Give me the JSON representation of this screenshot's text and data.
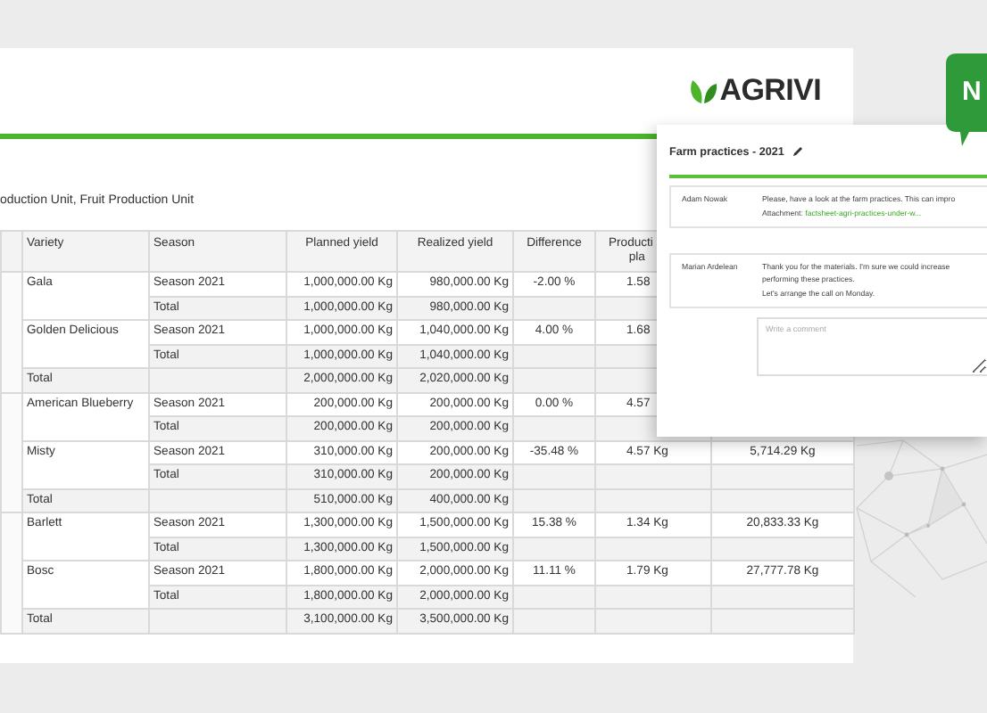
{
  "report": {
    "logo": "AGRIVI",
    "subtitle": "oduction Unit, Fruit Production Unit",
    "table": {
      "columns": [
        {
          "label": "Variety"
        },
        {
          "label": "Season"
        },
        {
          "label": "Planned yield"
        },
        {
          "label": "Realized yield"
        },
        {
          "label": "Difference"
        },
        {
          "label_lines": [
            "Producti",
            "pla"
          ]
        }
      ],
      "groups": [
        {
          "varieties": [
            {
              "name": "Gala",
              "rows": [
                {
                  "kind": "season",
                  "season": "Season 2021",
                  "planned": "1,000,000.00 Kg",
                  "realized": "980,000.00 Kg",
                  "difference": "-2.00 %",
                  "per_plant": "1.58"
                },
                {
                  "kind": "total",
                  "season": "Total",
                  "planned": "1,000,000.00 Kg",
                  "realized": "980,000.00 Kg"
                }
              ]
            },
            {
              "name": "Golden Delicious",
              "rows": [
                {
                  "kind": "season",
                  "season": "Season 2021",
                  "planned": "1,000,000.00 Kg",
                  "realized": "1,040,000.00 Kg",
                  "difference": "4.00 %",
                  "per_plant": "1.68"
                },
                {
                  "kind": "total",
                  "season": "Total",
                  "planned": "1,000,000.00 Kg",
                  "realized": "1,040,000.00 Kg"
                }
              ]
            }
          ],
          "total": {
            "label": "Total",
            "planned": "2,000,000.00 Kg",
            "realized": "2,020,000.00 Kg"
          }
        },
        {
          "varieties": [
            {
              "name": "American Blueberry",
              "rows": [
                {
                  "kind": "season",
                  "season": "Season 2021",
                  "planned": "200,000.00 Kg",
                  "realized": "200,000.00 Kg",
                  "difference": "0.00 %",
                  "per_plant": "4.57"
                },
                {
                  "kind": "total",
                  "season": "Total",
                  "planned": "200,000.00 Kg",
                  "realized": "200,000.00 Kg"
                }
              ]
            },
            {
              "name": "Misty",
              "rows": [
                {
                  "kind": "season",
                  "season": "Season 2021",
                  "planned": "310,000.00 Kg",
                  "realized": "200,000.00 Kg",
                  "difference": "-35.48 %",
                  "per_plant": "4.57 Kg",
                  "column_8": "5,714.29 Kg"
                },
                {
                  "kind": "total",
                  "season": "Total",
                  "planned": "310,000.00 Kg",
                  "realized": "200,000.00 Kg"
                }
              ]
            }
          ],
          "total": {
            "label": "Total",
            "planned": "510,000.00 Kg",
            "realized": "400,000.00 Kg"
          }
        },
        {
          "varieties": [
            {
              "name": "Barlett",
              "rows": [
                {
                  "kind": "season",
                  "season": "Season 2021",
                  "planned": "1,300,000.00 Kg",
                  "realized": "1,500,000.00 Kg",
                  "difference": "15.38 %",
                  "per_plant": "1.34 Kg",
                  "column_8": "20,833.33 Kg"
                },
                {
                  "kind": "total",
                  "season": "Total",
                  "planned": "1,300,000.00 Kg",
                  "realized": "1,500,000.00 Kg"
                }
              ]
            },
            {
              "name": "Bosc",
              "rows": [
                {
                  "kind": "season",
                  "season": "Season 2021",
                  "planned": "1,800,000.00 Kg",
                  "realized": "2,000,000.00 Kg",
                  "difference": "11.11 %",
                  "per_plant": "1.79 Kg",
                  "column_8": "27,777.78 Kg"
                },
                {
                  "kind": "total",
                  "season": "Total",
                  "planned": "1,800,000.00 Kg",
                  "realized": "2,000,000.00 Kg"
                }
              ]
            }
          ],
          "total": {
            "label": "Total",
            "planned": "3,100,000.00 Kg",
            "realized": "3,500,000.00 Kg"
          }
        }
      ]
    }
  },
  "popup": {
    "title": "Farm practices - 2021",
    "comments": [
      {
        "author": "Adam Nowak",
        "lines": [
          "Please, have a look at the farm practices. This can impro"
        ],
        "attachment_label": "Attachment:",
        "attachment_link": "factsheet-agri-practices-under-w..."
      },
      {
        "author": "Marian Ardelean",
        "lines": [
          "Thank you for the materials. I'm sure we could increase",
          "performing these practices.",
          "Let's arrange the call on Monday."
        ]
      }
    ],
    "comment_field": {
      "placeholder": "Write a comment"
    }
  },
  "bubble": {
    "text": "N"
  }
}
